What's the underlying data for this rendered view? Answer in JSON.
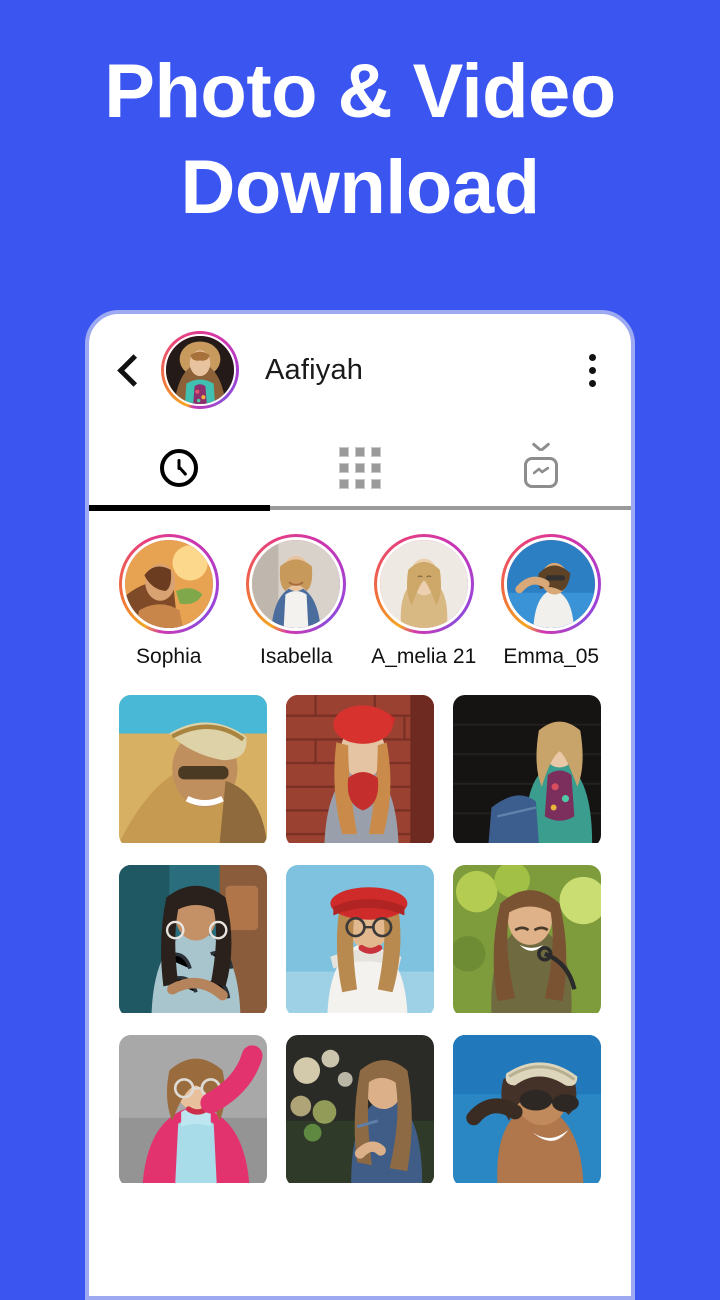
{
  "background_color": "#3b55f0",
  "headline": {
    "text": "Photo & Video\nDownload",
    "color": "#ffffff"
  },
  "phone": {
    "frame_border_color": "#9daaf2",
    "screen_color": "#ffffff"
  },
  "app_header": {
    "back_icon": "back-chevron-icon",
    "avatar_alt": "Aafiyah profile picture",
    "title": "Aafiyah",
    "menu_icon": "kebab-menu-icon",
    "ring_gradient": [
      "#f5a623",
      "#e8457a",
      "#a93fd0"
    ]
  },
  "tabs": {
    "active_index": 0,
    "underline_color": "#000000",
    "rail_color": "#9a9a9a",
    "items": [
      {
        "name": "recent",
        "icon": "clock-icon",
        "active": true
      },
      {
        "name": "posts",
        "icon": "grid-icon",
        "active": false
      },
      {
        "name": "igtv",
        "icon": "igtv-icon",
        "active": false
      }
    ]
  },
  "stories": [
    {
      "label": "Sophia"
    },
    {
      "label": "Isabella"
    },
    {
      "label": "A_melia 21"
    },
    {
      "label": "Emma_05"
    }
  ],
  "photo_grid": [
    {
      "caption": "Woman in headscarf and sunglasses at the beach"
    },
    {
      "caption": "Woman in red beanie and mittens by a brick wall"
    },
    {
      "caption": "Woman in teal floral jacket against a dark wall"
    },
    {
      "caption": "Woman in zebra print top with hoop earrings"
    },
    {
      "caption": "Woman in red hat and round glasses under blue sky"
    },
    {
      "caption": "Smiling woman holding sunglasses in green foliage"
    },
    {
      "caption": "Woman in pink coat and blue turtleneck"
    },
    {
      "caption": "Woman in denim jacket with city bokeh lights"
    },
    {
      "caption": "Woman with headband and sunglasses against blue sky"
    }
  ]
}
